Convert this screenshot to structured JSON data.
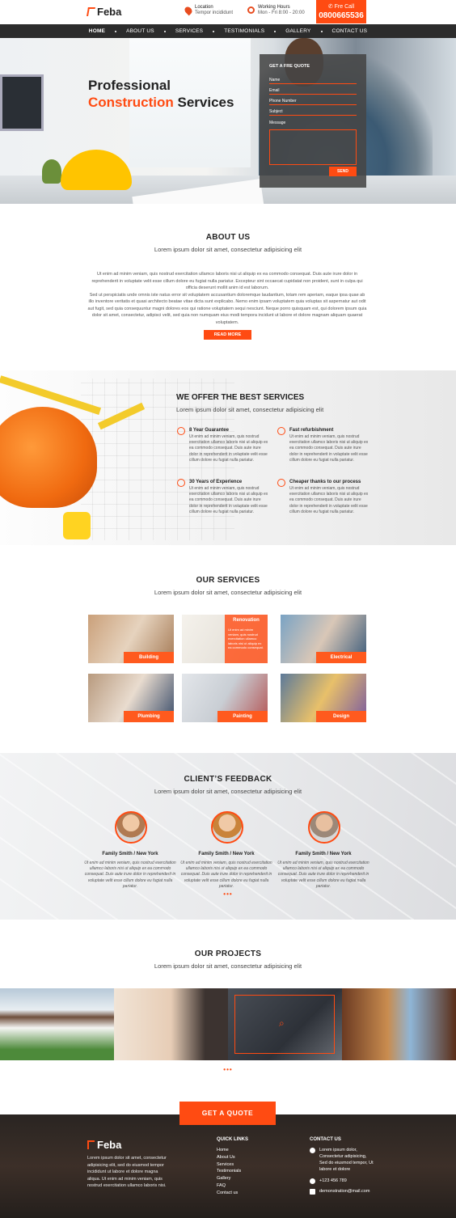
{
  "header": {
    "brand": "Feba",
    "location_title": "Location",
    "location_value": "Tempor incididunt",
    "hours_title": "Working Hours",
    "hours_value": "Mon - Fri 8:00 - 20:00",
    "call_label": "Fre Call",
    "call_number": "0800665536"
  },
  "nav": [
    "HOME",
    "ABOUT US",
    "SERVICES",
    "TESTIMONIALS",
    "GALLERY",
    "CONTACT US"
  ],
  "hero": {
    "line1": "Professional",
    "highlight": "Construction",
    "line2_rest": "Services"
  },
  "quote_form": {
    "title": "GET A FRE QUOTE",
    "fields": [
      "Name",
      "Email",
      "Phone Number",
      "Subject"
    ],
    "message_label": "Message",
    "send": "SEND"
  },
  "about": {
    "title": "ABOUT US",
    "subtitle": "Lorem ipsum dolor sit amet, consectetur adipisicing elit",
    "p1": "Ut enim ad minim veniam, quis nostrud exercitation ullamco laboris nisi ut aliquip ex ea commodo consequat. Duis aute irure dolor in reprehenderit in voluptate velit esse cillum dolore eu fugiat nulla pariatur. Excepteur sint occaecat cupidatat non proident, sunt in culpa qui officia deserunt mollit anim id est laborum.",
    "p2": "Sed ut perspiciatis unde omnis iste natus error sit voluptatem accusantium doloremque laudantium, totam rem aperiam, eaque ipsa quae ab illo inventore veritatis et quasi architecto beatae vitae dicta sunt explicabo. Nemo enim ipsam voluptatem quia voluptas sit aspernatur aut odit aut fugit, sed quia consequuntur magni dolores eos qui ratione voluptatem sequi nesciunt. Neque porro quisquam est, qui dolorem ipsum quia dolor sit amet, consectetur, adipisci velit, sed quia non numquam eius modi tempora incidunt ut labore et dolore magnam aliquam quaerat voluptatem.",
    "button": "READ MORE"
  },
  "offer": {
    "title": "WE OFFER THE BEST SERVICES",
    "subtitle": "Lorem ipsum dolor sit amet, consectetur adipisicing elit",
    "features": [
      {
        "title": "8 Year Guarantee",
        "text": "Ut enim ad minim veniam, quis nostrud exercitation ullamco laboris nisi ut aliquip ex ea commodo consequat. Duis aute irure dolor in reprehenderit in voluptate velit esse cillum dolore eu fugiat nulla pariatur."
      },
      {
        "title": "Fast refurbishment",
        "text": "Ut enim ad minim veniam, quis nostrud exercitation ullamco laboris nisi ut aliquip ex ea commodo consequat. Duis aute irure dolor in reprehenderit in voluptate velit esse cillum dolore eu fugiat nulla pariatur."
      },
      {
        "title": "30 Years of Experience",
        "text": "Ut enim ad minim veniam, quis nostrud exercitation ullamco laboris nisi ut aliquip ex ea commodo consequat. Duis aute irure dolor in reprehenderit in voluptate velit esse cillum dolore eu fugiat nulla pariatur."
      },
      {
        "title": "Cheaper thanks to our process",
        "text": "Ut enim ad minim veniam, quis nostrud exercitation ullamco laboris nisi ut aliquip ex ea commodo consequat. Duis aute irure dolor in reprehenderit in voluptate velit esse cillum dolore eu fugiat nulla pariatur."
      }
    ]
  },
  "services": {
    "title": "OUR SERVICES",
    "subtitle": "Lorem ipsum dolor sit amet, consectetur adipisicing elit",
    "items": [
      "Building",
      "Renovation",
      "Electrical",
      "Plumbing",
      "Painting",
      "Design"
    ],
    "renovation_text": "Ut enim ad minim veniam, quis nostrud exercitation ullamco laboris nisi ut aliquip ex ea commodo consequat."
  },
  "feedback": {
    "title": "CLIENT’S FEEDBACK",
    "subtitle": "Lorem ipsum dolor sit amet, consectetur adipisicing elit",
    "items": [
      {
        "name": "Family Smith / New York",
        "text": "Ut enim ad minim veniam, quis nostrud exercitation ullamco laboris nisi ut aliquip ex ea commodo consequat. Duis aute irure dolor in reprehenderit in voluptate velit esse cillum dolore eu fugiat nulla pariatur."
      },
      {
        "name": "Family Smith / New York",
        "text": "Ut enim ad minim veniam, quis nostrud exercitation ullamco laboris nisi ut aliquip ex ea commodo consequat. Duis aute irure dolor in reprehenderit in voluptate velit esse cillum dolore eu fugiat nulla pariatur."
      },
      {
        "name": "Family Smith / New York",
        "text": "Ut enim ad minim veniam, quis nostrud exercitation ullamco laboris nisi ut aliquip ex ea commodo consequat. Duis aute irure dolor in reprehenderit in voluptate velit esse cillum dolore eu fugiat nulla pariatur."
      }
    ],
    "dots": "•••"
  },
  "projects": {
    "title": "OUR PROJECTS",
    "subtitle": "Lorem ipsum dolor sit amet, consectetur adipisicing elit",
    "dots": "•••"
  },
  "cta": "GET A QUOTE",
  "footer": {
    "brand": "Feba",
    "description": "Lorem ipsum dolor sit amet, consectetur adipisicing elit, sed do eiusmod tempor incididunt ut labore et dolore magna aliqua. Ut enim ad minim veniam, quis nostrud exercitation ullamco laboris nisi.",
    "quick_links_title": "QUICK LINKS",
    "quick_links": [
      "Home",
      "About Us",
      "Services",
      "Testimonials",
      "Gallery",
      "FAQ",
      "Contact us"
    ],
    "contact_title": "CONTACT US",
    "address": "Lorem ipsum dolor, Consectetur adipisicing, Sed do eiusmod tempor, Ut labore et dolore",
    "phone": "+123 456 789",
    "email": "demonstration@mail.com"
  },
  "colors": {
    "accent": "#ff4b12",
    "nav": "#2c2c2c"
  }
}
